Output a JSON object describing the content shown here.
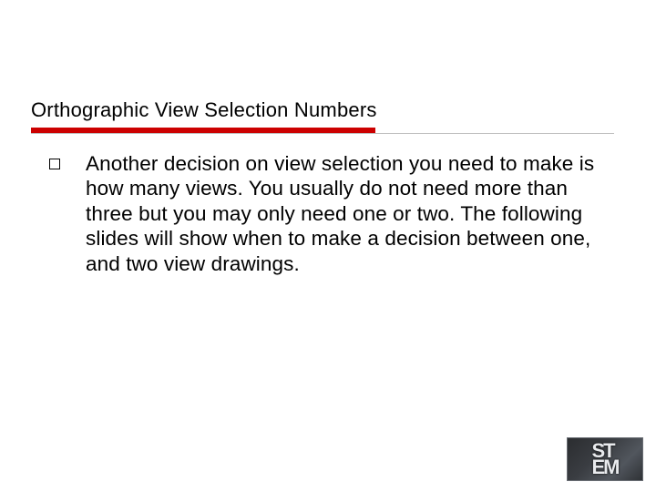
{
  "slide": {
    "title": "Orthographic View Selection Numbers",
    "bullets": [
      "Another decision on view selection you need to make is how many views. You usually do not need more than three but you may only need one or two.  The following slides will show when to make a decision between one, and two view drawings."
    ]
  },
  "logo": {
    "line1": "ST",
    "line2": "EM"
  },
  "colors": {
    "accent": "#cc0000"
  }
}
